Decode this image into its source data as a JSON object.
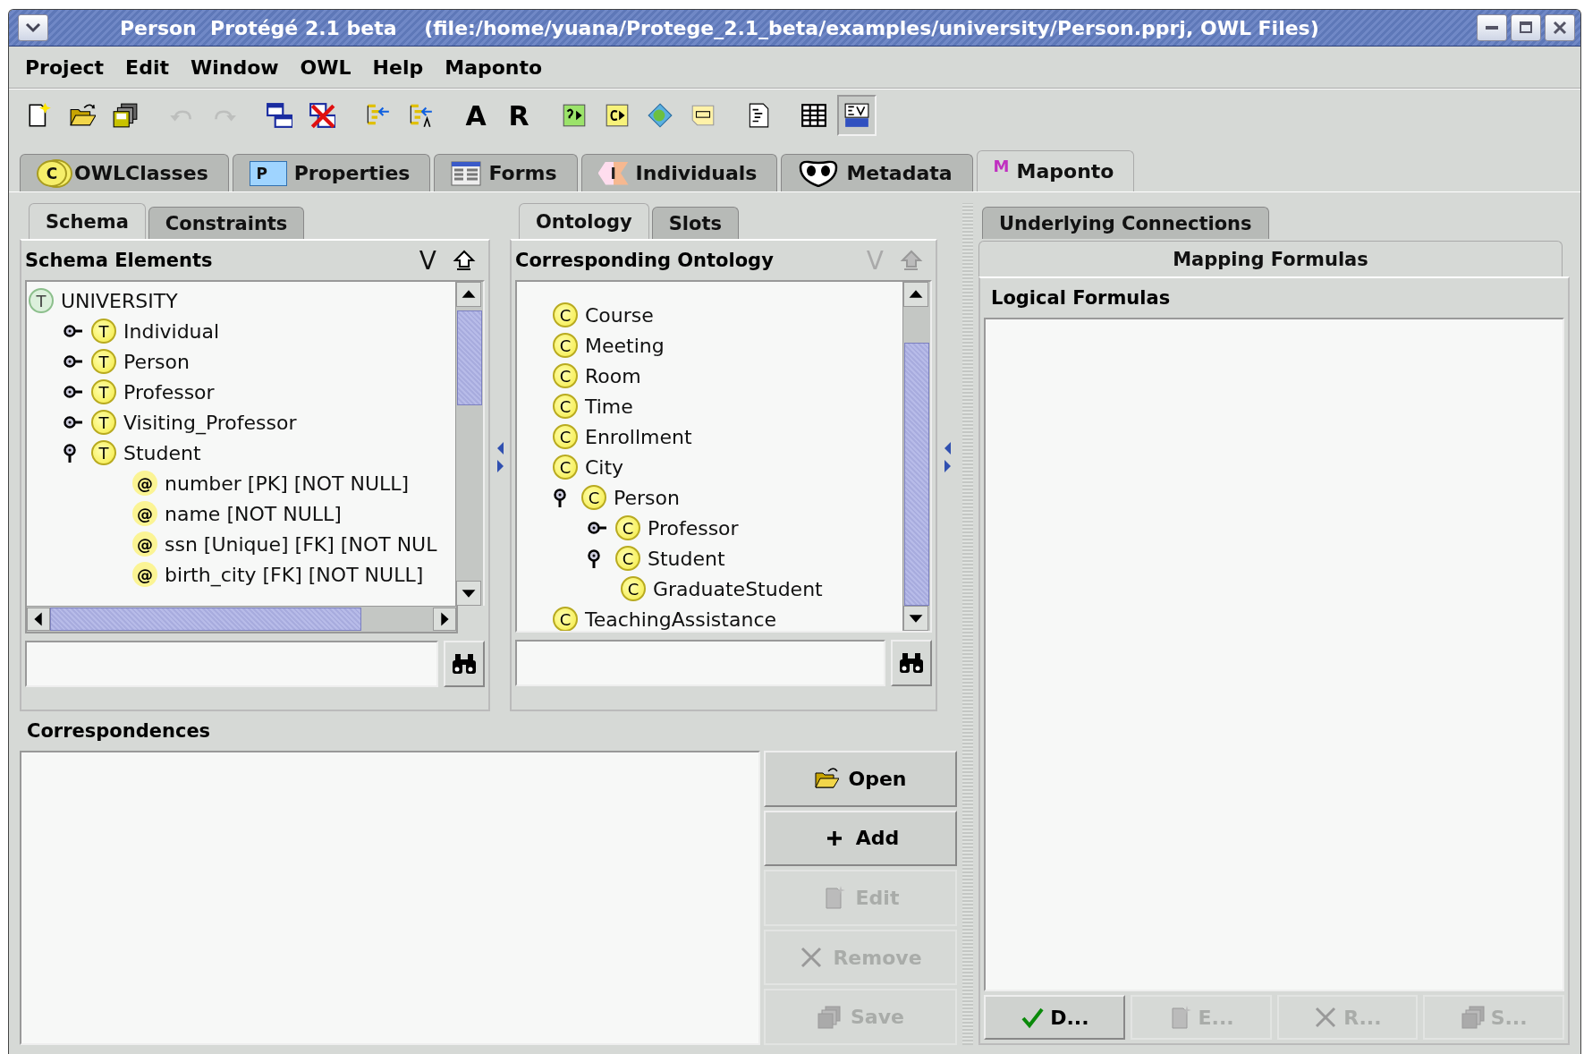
{
  "window": {
    "title": "Person  Protégé 2.1 beta    (file:/home/yuana/Protege_2.1_beta/examples/university/Person.pprj, OWL Files)"
  },
  "menu": [
    "Project",
    "Edit",
    "Window",
    "OWL",
    "Help",
    "Maponto"
  ],
  "toolbar": [
    {
      "kind": "icon",
      "disabled": false,
      "pressed": false
    },
    {
      "kind": "icon",
      "disabled": false,
      "pressed": false
    },
    {
      "kind": "icon",
      "disabled": false,
      "pressed": false
    },
    {
      "kind": "icon",
      "disabled": true,
      "pressed": false
    },
    {
      "kind": "icon",
      "disabled": true,
      "pressed": false
    },
    {
      "kind": "icon",
      "disabled": false,
      "pressed": false
    },
    {
      "kind": "icon",
      "disabled": false,
      "pressed": false
    },
    {
      "kind": "icon",
      "disabled": false,
      "pressed": false
    },
    {
      "kind": "icon",
      "disabled": false,
      "pressed": false
    },
    {
      "kind": "text",
      "label": "A",
      "disabled": false,
      "pressed": false
    },
    {
      "kind": "text",
      "label": "R",
      "disabled": false,
      "pressed": false
    },
    {
      "kind": "icon",
      "disabled": false,
      "pressed": false
    },
    {
      "kind": "icon",
      "disabled": false,
      "pressed": false
    },
    {
      "kind": "icon",
      "disabled": false,
      "pressed": false
    },
    {
      "kind": "icon",
      "disabled": false,
      "pressed": false
    },
    {
      "kind": "icon",
      "disabled": false,
      "pressed": false
    },
    {
      "kind": "icon",
      "disabled": false,
      "pressed": false
    },
    {
      "kind": "icon",
      "disabled": false,
      "pressed": true
    }
  ],
  "tabs": [
    {
      "label": "OWLClasses",
      "badge": "C",
      "selected": false
    },
    {
      "label": "Properties",
      "badge": "P",
      "selected": false
    },
    {
      "label": "Forms",
      "selected": false
    },
    {
      "label": "Individuals",
      "badge": "I",
      "selected": false
    },
    {
      "label": "Metadata",
      "selected": false
    },
    {
      "label": "Maponto",
      "badge": "M",
      "selected": true
    }
  ],
  "schema_pane": {
    "tabs": [
      {
        "label": "Schema",
        "selected": true
      },
      {
        "label": "Constraints",
        "selected": false
      }
    ],
    "title": "Schema Elements",
    "view_action": {
      "label": "V",
      "disabled": false
    },
    "up_action": {
      "disabled": false
    },
    "tree": [
      {
        "label": "UNIVERSITY",
        "kind": "schema",
        "badge": "T",
        "children": [
          {
            "label": "Individual",
            "kind": "table",
            "badge": "T",
            "expanded": false
          },
          {
            "label": "Person",
            "kind": "table",
            "badge": "T",
            "expanded": false
          },
          {
            "label": "Professor",
            "kind": "table",
            "badge": "T",
            "expanded": false
          },
          {
            "label": "Visiting_Professor",
            "kind": "table",
            "badge": "T",
            "expanded": false
          },
          {
            "label": "Student",
            "kind": "table",
            "badge": "T",
            "expanded": true,
            "children": [
              {
                "label": "number [PK] [NOT NULL]",
                "kind": "column",
                "badge": "@"
              },
              {
                "label": "name [NOT NULL]",
                "kind": "column",
                "badge": "@"
              },
              {
                "label": "ssn [Unique] [FK] [NOT NUL",
                "kind": "column",
                "badge": "@"
              },
              {
                "label": "birth_city [FK] [NOT NULL]",
                "kind": "column",
                "badge": "@"
              }
            ]
          }
        ]
      }
    ]
  },
  "ontology_pane": {
    "tabs": [
      {
        "label": "Ontology",
        "selected": true
      },
      {
        "label": "Slots",
        "selected": false
      }
    ],
    "title": "Corresponding Ontology",
    "view_action": {
      "label": "V",
      "disabled": true
    },
    "up_action": {
      "disabled": true
    },
    "tree": [
      {
        "label": "Course",
        "kind": "class",
        "badge": "C"
      },
      {
        "label": "Meeting",
        "kind": "class",
        "badge": "C"
      },
      {
        "label": "Room",
        "kind": "class",
        "badge": "C"
      },
      {
        "label": "Time",
        "kind": "class",
        "badge": "C"
      },
      {
        "label": "Enrollment",
        "kind": "class",
        "badge": "C"
      },
      {
        "label": "City",
        "kind": "class",
        "badge": "C"
      },
      {
        "label": "Person",
        "kind": "class",
        "badge": "C",
        "expanded": true,
        "children": [
          {
            "label": "Professor",
            "kind": "class",
            "badge": "C",
            "expanded": false
          },
          {
            "label": "Student",
            "kind": "class",
            "badge": "C",
            "expanded": true,
            "children": [
              {
                "label": "GraduateStudent",
                "kind": "class",
                "badge": "C"
              }
            ]
          }
        ]
      },
      {
        "label": "TeachingAssistance",
        "kind": "class",
        "badge": "C"
      }
    ]
  },
  "correspondences": {
    "title": "Correspondences",
    "buttons": [
      {
        "label": "Open",
        "disabled": false
      },
      {
        "label": "Add",
        "disabled": false
      },
      {
        "label": "Edit",
        "disabled": true
      },
      {
        "label": "Remove",
        "disabled": true
      },
      {
        "label": "Save",
        "disabled": true
      }
    ]
  },
  "formulas_pane": {
    "tabs": [
      {
        "label": "Underlying Connections",
        "selected": false
      },
      {
        "label": "Mapping Formulas",
        "selected": true
      }
    ],
    "title": "Logical Formulas",
    "buttons": [
      {
        "label": "D...",
        "disabled": false
      },
      {
        "label": "E...",
        "disabled": true
      },
      {
        "label": "R...",
        "disabled": true
      },
      {
        "label": "S...",
        "disabled": true
      }
    ]
  }
}
